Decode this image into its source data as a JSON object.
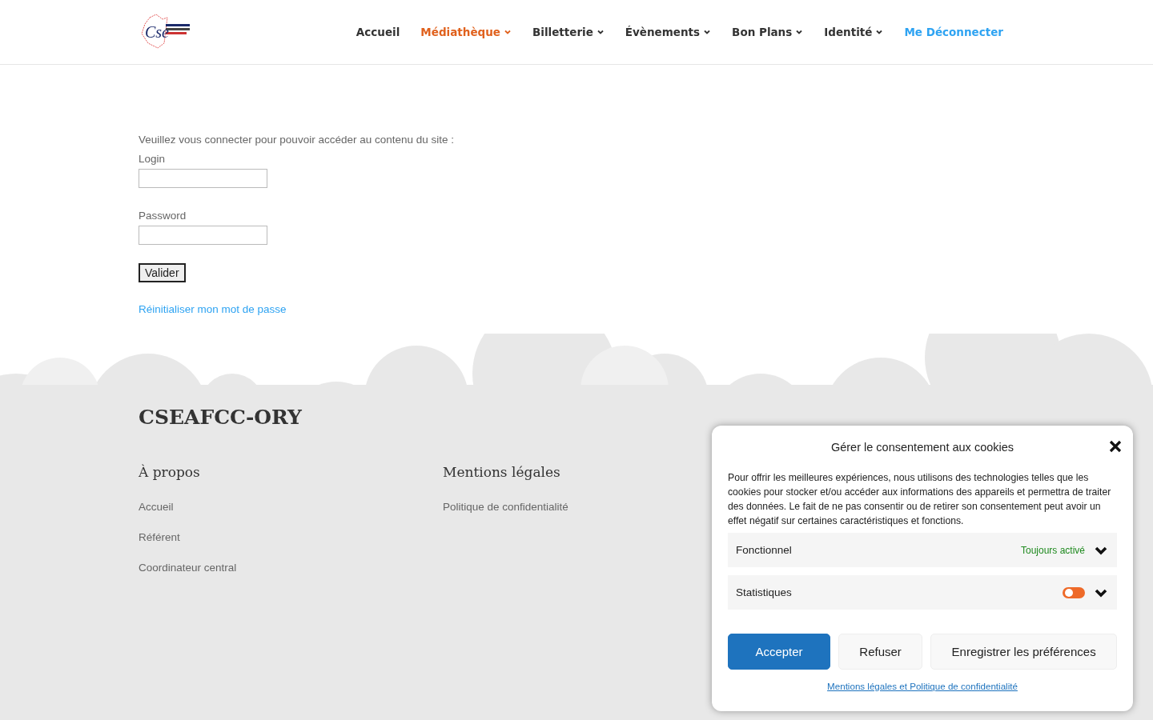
{
  "header": {
    "logo": {
      "text": "Cse"
    },
    "nav": [
      {
        "label": "Accueil",
        "selected": false,
        "dropdown": false,
        "kind": "menu"
      },
      {
        "label": "Médiathèque",
        "selected": true,
        "dropdown": true,
        "kind": "menu"
      },
      {
        "label": "Billetterie",
        "selected": false,
        "dropdown": true,
        "kind": "menu"
      },
      {
        "label": "Évènements",
        "selected": false,
        "dropdown": true,
        "kind": "menu"
      },
      {
        "label": "Bon Plans",
        "selected": false,
        "dropdown": true,
        "kind": "menu"
      },
      {
        "label": "Identité",
        "selected": false,
        "dropdown": true,
        "kind": "menu"
      },
      {
        "label": "Me Déconnecter",
        "selected": false,
        "dropdown": false,
        "kind": "account"
      }
    ]
  },
  "login": {
    "intro": "Veuillez vous connecter pour pouvoir accéder au contenu du site :",
    "fields": [
      {
        "label": "Login"
      },
      {
        "label": "Password"
      }
    ],
    "submit": "Valider",
    "reset_link": "Réinitialiser mon mot de passe"
  },
  "footer": {
    "title": "CSEAFCC-ORY",
    "columns": [
      {
        "heading": "À propos",
        "links": [
          "Accueil",
          "Référent",
          "Coordinateur central"
        ]
      },
      {
        "heading": "Mentions légales",
        "links": [
          "Politique de confidentialité"
        ]
      }
    ]
  },
  "cookie_dialog": {
    "title": "Gérer le consentement aux cookies",
    "text": "Pour offrir les meilleures expériences, nous utilisons des technologies telles que les cookies pour stocker et/ou accéder aux informations des appareils et permettra de traiter des données. Le fait de ne pas consentir ou de retirer son consentement peut avoir un effet négatif sur certaines caractéristiques et fonctions.",
    "categories": [
      {
        "name": "Fonctionnel",
        "kind": "always",
        "status": "Toujours activé"
      },
      {
        "name": "Statistiques",
        "kind": "toggle",
        "on": false
      }
    ],
    "buttons": [
      {
        "label": "Accepter",
        "kind": "primary"
      },
      {
        "label": "Refuser",
        "kind": "secondary"
      },
      {
        "label": "Enregistrer les préférences",
        "kind": "secondary"
      }
    ],
    "link": "Mentions légales et Politique de confidentialité"
  }
}
